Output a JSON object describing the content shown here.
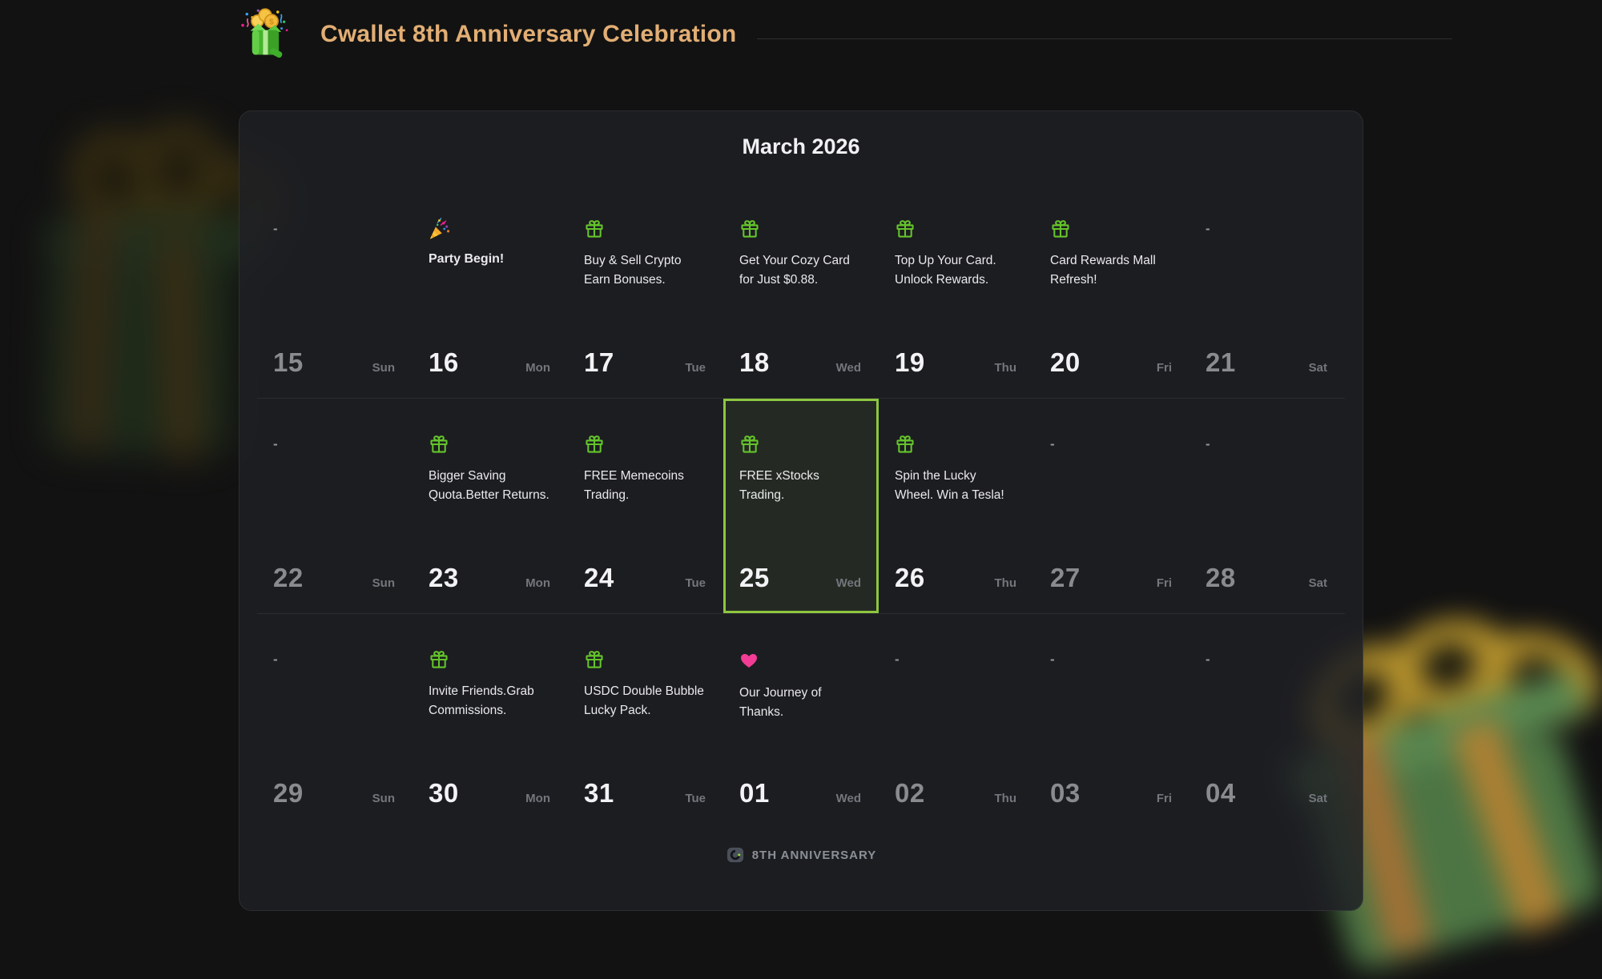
{
  "header": {
    "title": "Cwallet 8th Anniversary Celebration",
    "logo_icon": "gift-box-celebration-icon"
  },
  "calendar": {
    "month_title": "March 2026",
    "empty_marker": "-",
    "weeks": [
      {
        "days": [
          {
            "date": "15",
            "weekday": "Sun",
            "dim": true
          },
          {
            "date": "16",
            "weekday": "Mon",
            "event": {
              "icon": "party-popper-icon",
              "text": "Party Begin!",
              "emphasis": true
            }
          },
          {
            "date": "17",
            "weekday": "Tue",
            "event": {
              "icon": "gift-icon",
              "text": "Buy & Sell Crypto Earn Bonuses."
            }
          },
          {
            "date": "18",
            "weekday": "Wed",
            "event": {
              "icon": "gift-icon",
              "text": "Get Your Cozy Card for Just $0.88."
            }
          },
          {
            "date": "19",
            "weekday": "Thu",
            "event": {
              "icon": "gift-icon",
              "text": "Top Up Your Card. Unlock Rewards."
            }
          },
          {
            "date": "20",
            "weekday": "Fri",
            "event": {
              "icon": "gift-icon",
              "text": "Card Rewards Mall Refresh!"
            }
          },
          {
            "date": "21",
            "weekday": "Sat",
            "dim": true
          }
        ]
      },
      {
        "days": [
          {
            "date": "22",
            "weekday": "Sun",
            "dim": true
          },
          {
            "date": "23",
            "weekday": "Mon",
            "event": {
              "icon": "gift-icon",
              "text": "Bigger Saving Quota.Better Returns."
            }
          },
          {
            "date": "24",
            "weekday": "Tue",
            "event": {
              "icon": "gift-icon",
              "text": "FREE Memecoins Trading."
            }
          },
          {
            "date": "25",
            "weekday": "Wed",
            "highlighted": true,
            "event": {
              "icon": "gift-icon",
              "text": "FREE xStocks Trading."
            }
          },
          {
            "date": "26",
            "weekday": "Thu",
            "event": {
              "icon": "gift-icon",
              "text": "Spin the Lucky Wheel. Win a Tesla!"
            }
          },
          {
            "date": "27",
            "weekday": "Fri",
            "dim": true
          },
          {
            "date": "28",
            "weekday": "Sat",
            "dim": true
          }
        ]
      },
      {
        "days": [
          {
            "date": "29",
            "weekday": "Sun",
            "dim": true
          },
          {
            "date": "30",
            "weekday": "Mon",
            "event": {
              "icon": "gift-icon",
              "text": "Invite Friends.Grab Commissions."
            }
          },
          {
            "date": "31",
            "weekday": "Tue",
            "event": {
              "icon": "gift-icon",
              "text": "USDC Double Bubble Lucky Pack."
            }
          },
          {
            "date": "01",
            "weekday": "Wed",
            "event": {
              "icon": "heart-icon",
              "text": "Our Journey of Thanks."
            }
          },
          {
            "date": "02",
            "weekday": "Thu",
            "dim": true
          },
          {
            "date": "03",
            "weekday": "Fri",
            "dim": true
          },
          {
            "date": "04",
            "weekday": "Sat",
            "dim": true
          }
        ]
      }
    ]
  },
  "footer": {
    "label": "8TH ANNIVERSARY",
    "logo_icon": "cwallet-logo-icon"
  },
  "colors": {
    "accent_green": "#8dc63f",
    "icon_green": "#64c42b",
    "heart_pink": "#f23c96",
    "title_gold": "#e2ae74"
  }
}
